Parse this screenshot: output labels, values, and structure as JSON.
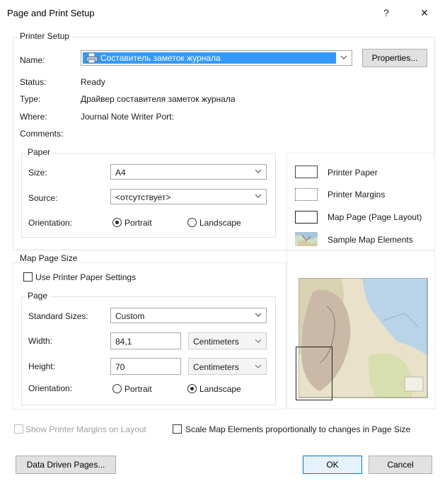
{
  "window": {
    "title": "Page and Print Setup",
    "help_glyph": "?",
    "close_glyph": "✕"
  },
  "printer_setup": {
    "group_label": "Printer Setup",
    "name_label": "Name:",
    "name_value": "Составитель заметок журнала",
    "properties_button": "Properties...",
    "status_label": "Status:",
    "status_value": "Ready",
    "type_label": "Type:",
    "type_value": "Драйвер составителя заметок журнала",
    "where_label": "Where:",
    "where_value": "Journal Note Writer Port:",
    "comments_label": "Comments:",
    "comments_value": ""
  },
  "paper": {
    "group_label": "Paper",
    "size_label": "Size:",
    "size_value": "A4",
    "source_label": "Source:",
    "source_value": "<отсутствует>",
    "orientation_label": "Orientation:",
    "portrait_label": "Portrait",
    "landscape_label": "Landscape",
    "orientation_selected": "Portrait"
  },
  "legend": {
    "printer_paper": "Printer Paper",
    "printer_margins": "Printer Margins",
    "map_page": "Map Page (Page Layout)",
    "sample_map_elements": "Sample Map Elements"
  },
  "map_page_size": {
    "group_label": "Map Page Size",
    "use_printer_paper": "Use Printer Paper Settings",
    "use_printer_paper_checked": false,
    "page_group_label": "Page",
    "standard_sizes_label": "Standard Sizes:",
    "standard_sizes_value": "Custom",
    "width_label": "Width:",
    "width_value": "84,1",
    "width_unit": "Centimeters",
    "height_label": "Height:",
    "height_value": "70",
    "height_unit": "Centimeters",
    "orientation_label": "Orientation:",
    "portrait_label": "Portrait",
    "landscape_label": "Landscape",
    "orientation_selected": "Landscape"
  },
  "footer": {
    "show_margins_label": "Show Printer Margins on Layout",
    "scale_elements_label": "Scale Map Elements proportionally to changes in Page Size",
    "data_driven_pages_button": "Data Driven Pages...",
    "ok_button": "OK",
    "cancel_button": "Cancel"
  },
  "colors": {
    "selection": "#3399ff",
    "accent_border": "#0078d7"
  },
  "icons": {
    "printer": "printer-icon",
    "dropdown": "chevron-down-icon",
    "sample_map": "map-thumbnail-icon"
  }
}
